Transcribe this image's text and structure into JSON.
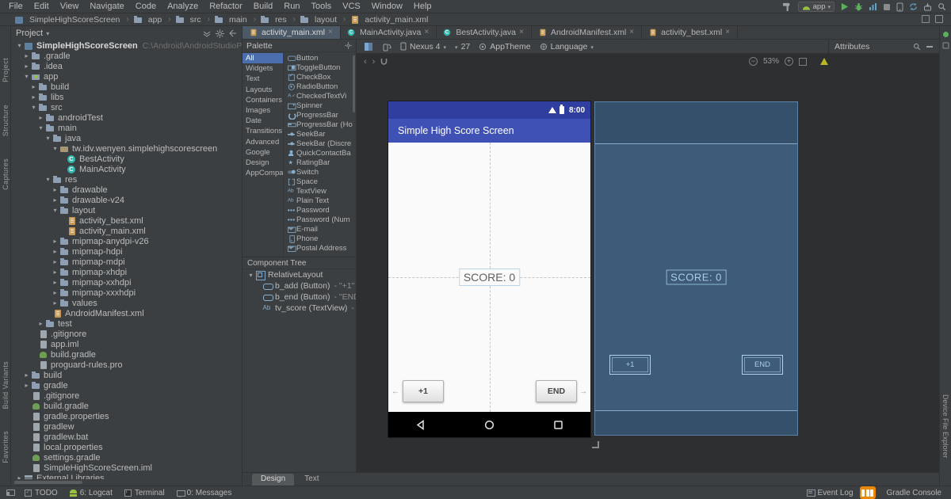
{
  "colors": {
    "panel": "#3c3f41",
    "border": "#323232",
    "canvas": "#2d2f31",
    "selection": "#4b6eaf",
    "appbar": "#3f51b5",
    "appbar-dark": "#303f9f",
    "blueprint": "#3e5c7a",
    "blueprint-line": "#85aac9",
    "watermark": "#e8890c"
  },
  "menubar": {
    "items": [
      "File",
      "Edit",
      "View",
      "Navigate",
      "Code",
      "Analyze",
      "Refactor",
      "Build",
      "Run",
      "Tools",
      "VCS",
      "Window",
      "Help"
    ]
  },
  "toolbar": {
    "run_config": "app"
  },
  "navbar": {
    "breadcrumbs": [
      {
        "label": "SimpleHighScoreScreen",
        "icon": "project"
      },
      {
        "label": "app",
        "icon": "folder"
      },
      {
        "label": "src",
        "icon": "folder"
      },
      {
        "label": "main",
        "icon": "folder"
      },
      {
        "label": "res",
        "icon": "folder"
      },
      {
        "label": "layout",
        "icon": "folder"
      },
      {
        "label": "activity_main.xml",
        "icon": "xml"
      }
    ]
  },
  "side_strips": {
    "left_top": [
      "Project",
      "Structure",
      "Captures"
    ],
    "left_bottom": [
      "Build Variants",
      "Favorites"
    ],
    "right_bottom": [
      "Device File Explorer"
    ]
  },
  "project": {
    "title": "Project",
    "tree": [
      {
        "label": "SimpleHighScoreScreen",
        "path": "C:\\Android\\AndroidStudioProjects\\SimpleHighSc",
        "indent": 0,
        "icon": "project",
        "arrow": "expanded",
        "bold": true
      },
      {
        "label": ".gradle",
        "indent": 1,
        "icon": "folder",
        "arrow": "collapsed"
      },
      {
        "label": ".idea",
        "indent": 1,
        "icon": "folder",
        "arrow": "collapsed"
      },
      {
        "label": "app",
        "indent": 1,
        "icon": "android",
        "arrow": "expanded"
      },
      {
        "label": "build",
        "indent": 2,
        "icon": "folder",
        "arrow": "collapsed"
      },
      {
        "label": "libs",
        "indent": 2,
        "icon": "folder",
        "arrow": "collapsed"
      },
      {
        "label": "src",
        "indent": 2,
        "icon": "folder",
        "arrow": "expanded"
      },
      {
        "label": "androidTest",
        "indent": 3,
        "icon": "folder",
        "arrow": "collapsed"
      },
      {
        "label": "main",
        "indent": 3,
        "icon": "folder",
        "arrow": "expanded"
      },
      {
        "label": "java",
        "indent": 4,
        "icon": "folder",
        "arrow": "expanded"
      },
      {
        "label": "tw.idv.wenyen.simplehighscorescreen",
        "indent": 5,
        "icon": "package",
        "arrow": "expanded"
      },
      {
        "label": "BestActivity",
        "indent": 6,
        "icon": "class",
        "arrow": "none"
      },
      {
        "label": "MainActivity",
        "indent": 6,
        "icon": "class",
        "arrow": "none"
      },
      {
        "label": "res",
        "indent": 4,
        "icon": "folder",
        "arrow": "expanded"
      },
      {
        "label": "drawable",
        "indent": 5,
        "icon": "folder",
        "arrow": "collapsed"
      },
      {
        "label": "drawable-v24",
        "indent": 5,
        "icon": "folder",
        "arrow": "collapsed"
      },
      {
        "label": "layout",
        "indent": 5,
        "icon": "folder",
        "arrow": "expanded"
      },
      {
        "label": "activity_best.xml",
        "indent": 6,
        "icon": "xml",
        "arrow": "none"
      },
      {
        "label": "activity_main.xml",
        "indent": 6,
        "icon": "xml",
        "arrow": "none"
      },
      {
        "label": "mipmap-anydpi-v26",
        "indent": 5,
        "icon": "folder",
        "arrow": "collapsed"
      },
      {
        "label": "mipmap-hdpi",
        "indent": 5,
        "icon": "folder",
        "arrow": "collapsed"
      },
      {
        "label": "mipmap-mdpi",
        "indent": 5,
        "icon": "folder",
        "arrow": "collapsed"
      },
      {
        "label": "mipmap-xhdpi",
        "indent": 5,
        "icon": "folder",
        "arrow": "collapsed"
      },
      {
        "label": "mipmap-xxhdpi",
        "indent": 5,
        "icon": "folder",
        "arrow": "collapsed"
      },
      {
        "label": "mipmap-xxxhdpi",
        "indent": 5,
        "icon": "folder",
        "arrow": "collapsed"
      },
      {
        "label": "values",
        "indent": 5,
        "icon": "folder",
        "arrow": "collapsed"
      },
      {
        "label": "AndroidManifest.xml",
        "indent": 4,
        "icon": "manifest",
        "arrow": "none"
      },
      {
        "label": "test",
        "indent": 3,
        "icon": "folder",
        "arrow": "collapsed"
      },
      {
        "label": ".gitignore",
        "indent": 2,
        "icon": "file",
        "arrow": "none"
      },
      {
        "label": "app.iml",
        "indent": 2,
        "icon": "file",
        "arrow": "none"
      },
      {
        "label": "build.gradle",
        "indent": 2,
        "icon": "gradle",
        "arrow": "none"
      },
      {
        "label": "proguard-rules.pro",
        "indent": 2,
        "icon": "file",
        "arrow": "none"
      },
      {
        "label": "build",
        "indent": 1,
        "icon": "folder",
        "arrow": "collapsed"
      },
      {
        "label": "gradle",
        "indent": 1,
        "icon": "folder",
        "arrow": "collapsed"
      },
      {
        "label": ".gitignore",
        "indent": 1,
        "icon": "file",
        "arrow": "none"
      },
      {
        "label": "build.gradle",
        "indent": 1,
        "icon": "gradle",
        "arrow": "none"
      },
      {
        "label": "gradle.properties",
        "indent": 1,
        "icon": "file",
        "arrow": "none"
      },
      {
        "label": "gradlew",
        "indent": 1,
        "icon": "file",
        "arrow": "none"
      },
      {
        "label": "gradlew.bat",
        "indent": 1,
        "icon": "file",
        "arrow": "none"
      },
      {
        "label": "local.properties",
        "indent": 1,
        "icon": "file",
        "arrow": "none"
      },
      {
        "label": "settings.gradle",
        "indent": 1,
        "icon": "gradle",
        "arrow": "none"
      },
      {
        "label": "SimpleHighScoreScreen.iml",
        "indent": 1,
        "icon": "file",
        "arrow": "none"
      },
      {
        "label": "External Libraries",
        "indent": 0,
        "icon": "lib",
        "arrow": "collapsed"
      }
    ]
  },
  "editor_tabs": [
    {
      "label": "activity_main.xml",
      "icon": "xml",
      "active": true
    },
    {
      "label": "MainActivity.java",
      "icon": "class",
      "active": false
    },
    {
      "label": "BestActivity.java",
      "icon": "class",
      "active": false
    },
    {
      "label": "AndroidManifest.xml",
      "icon": "manifest",
      "active": false
    },
    {
      "label": "activity_best.xml",
      "icon": "xml",
      "active": false
    }
  ],
  "palette": {
    "title": "Palette",
    "categories": [
      {
        "label": "All",
        "selected": true
      },
      {
        "label": "Widgets",
        "selected": false
      },
      {
        "label": "Text",
        "selected": false
      },
      {
        "label": "Layouts",
        "selected": false
      },
      {
        "label": "Containers",
        "selected": false
      },
      {
        "label": "Images",
        "selected": false
      },
      {
        "label": "Date",
        "selected": false
      },
      {
        "label": "Transitions",
        "selected": false
      },
      {
        "label": "Advanced",
        "selected": false
      },
      {
        "label": "Google",
        "selected": false
      },
      {
        "label": "Design",
        "selected": false
      },
      {
        "label": "AppCompat",
        "selected": false
      }
    ],
    "components": [
      {
        "label": "Button",
        "icon": "button"
      },
      {
        "label": "ToggleButton",
        "icon": "toggle"
      },
      {
        "label": "CheckBox",
        "icon": "checkbox"
      },
      {
        "label": "RadioButton",
        "icon": "radio"
      },
      {
        "label": "CheckedTextVi",
        "icon": "checkedtext"
      },
      {
        "label": "Spinner",
        "icon": "spinner"
      },
      {
        "label": "ProgressBar",
        "icon": "progress"
      },
      {
        "label": "ProgressBar (Ho",
        "icon": "progressh"
      },
      {
        "label": "SeekBar",
        "icon": "seekbar"
      },
      {
        "label": "SeekBar (Discre",
        "icon": "seekbar"
      },
      {
        "label": "QuickContactBa",
        "icon": "contact"
      },
      {
        "label": "RatingBar",
        "icon": "rating"
      },
      {
        "label": "Switch",
        "icon": "switch"
      },
      {
        "label": "Space",
        "icon": "space"
      },
      {
        "label": "TextView",
        "icon": "ab"
      },
      {
        "label": "Plain Text",
        "icon": "ab"
      },
      {
        "label": "Password",
        "icon": "password"
      },
      {
        "label": "Password (Num",
        "icon": "password"
      },
      {
        "label": "E-mail",
        "icon": "email"
      },
      {
        "label": "Phone",
        "icon": "phone"
      },
      {
        "label": "Postal Address",
        "icon": "postal"
      }
    ]
  },
  "component_tree": {
    "title": "Component Tree",
    "items": [
      {
        "label": "RelativeLayout",
        "detail": "",
        "indent": 0,
        "icon": "layout",
        "arrow": "expanded"
      },
      {
        "label": "b_add (Button)",
        "detail": "- \"+1\"",
        "indent": 1,
        "icon": "button",
        "arrow": "none"
      },
      {
        "label": "b_end (Button)",
        "detail": "- \"END\"",
        "indent": 1,
        "icon": "button",
        "arrow": "none"
      },
      {
        "label": "tv_score (TextView)",
        "detail": "- \"SCOR",
        "indent": 1,
        "icon": "ab",
        "arrow": "none"
      }
    ]
  },
  "design_toolbar": {
    "device": "Nexus 4",
    "api": "27",
    "theme": "AppTheme",
    "language": "Language",
    "zoom": "53%"
  },
  "attributes": {
    "title": "Attributes"
  },
  "canvas": {
    "time": "8:00",
    "app_title": "Simple High Score Screen",
    "score": "SCORE: 0",
    "btn_add": "+1",
    "btn_end": "END"
  },
  "bottom_tabs": [
    {
      "label": "Design",
      "active": true
    },
    {
      "label": "Text",
      "active": false
    }
  ],
  "statusbar": {
    "left": [
      {
        "label": "TODO",
        "icon": "todo"
      },
      {
        "label": "6: Logcat",
        "icon": "logcat"
      },
      {
        "label": "Terminal",
        "icon": "terminal"
      },
      {
        "label": "0: Messages",
        "icon": "messages"
      }
    ],
    "event_log": "Event Log",
    "gradle_console": "Gradle Console"
  }
}
